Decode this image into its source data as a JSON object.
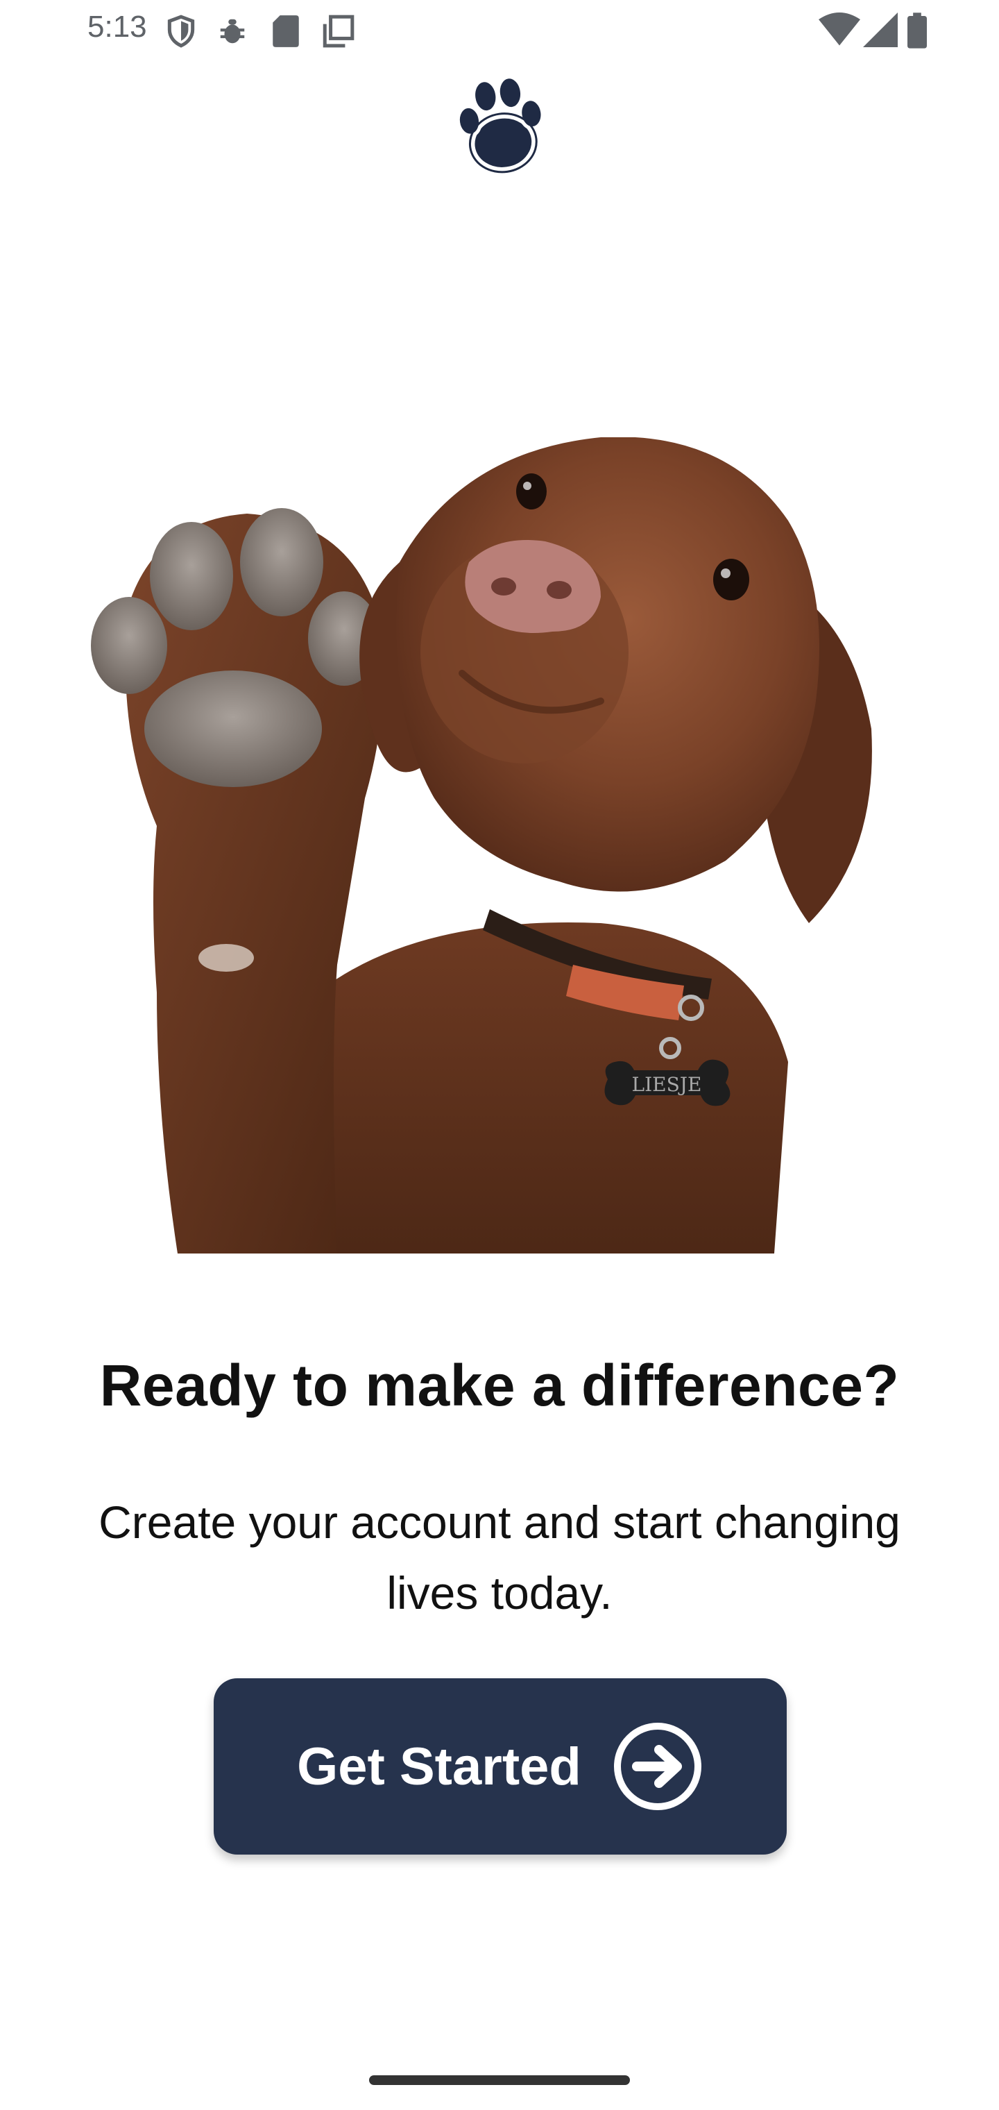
{
  "status_bar": {
    "time": "5:13",
    "icons_left": [
      "shield-icon",
      "bug-icon",
      "sd-card-icon",
      "copy-icon"
    ],
    "icons_right": [
      "wifi-icon",
      "cell-signal-icon",
      "battery-icon"
    ]
  },
  "logo": {
    "icon": "paw-icon",
    "color": "#1f2a44"
  },
  "hero": {
    "image_subject": "puppy-raising-paw"
  },
  "content": {
    "headline": "Ready to make a difference?",
    "subtext": "Create your account and start changing lives today."
  },
  "cta": {
    "label": "Get Started",
    "icon": "arrow-right-circle-icon",
    "background": "#26334d",
    "text_color": "#ffffff"
  }
}
